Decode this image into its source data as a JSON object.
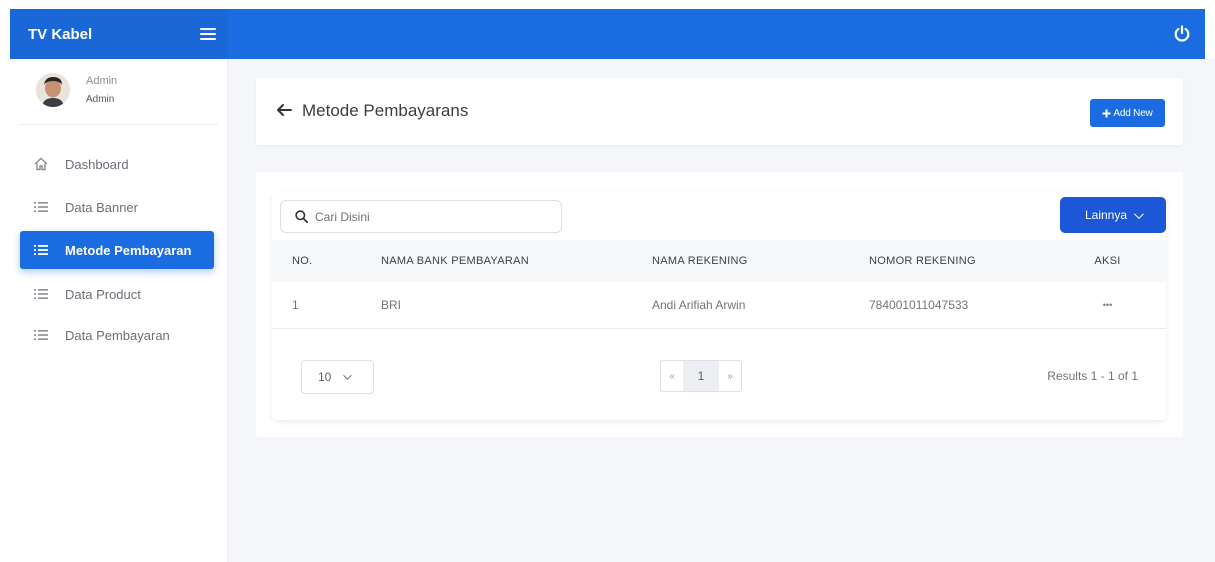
{
  "app": {
    "brand": "TV Kabel"
  },
  "profile": {
    "name": "Admin",
    "role": "Admin"
  },
  "sidebar": {
    "items": [
      {
        "label": "Dashboard",
        "icon": "home-icon",
        "active": false
      },
      {
        "label": "Data Banner",
        "icon": "list-icon",
        "active": false
      },
      {
        "label": "Metode Pembayaran",
        "icon": "list-icon",
        "active": true
      },
      {
        "label": "Data Product",
        "icon": "list-icon",
        "active": false
      },
      {
        "label": "Data Pembayaran",
        "icon": "list-icon",
        "active": false
      }
    ]
  },
  "header": {
    "title": "Metode Pembayarans",
    "add_label": "Add New"
  },
  "toolbar": {
    "search_placeholder": "Cari Disini",
    "more_label": "Lainnya"
  },
  "table": {
    "columns": [
      "NO.",
      "NAMA BANK PEMBAYARAN",
      "NAMA REKENING",
      "NOMOR REKENING",
      "AKSI"
    ],
    "rows": [
      {
        "no": "1",
        "bank": "BRI",
        "account_name": "Andi Arifiah Arwin",
        "account_number": "784001011047533",
        "action": "•••"
      }
    ]
  },
  "pagination": {
    "per_page": "10",
    "prev": "«",
    "current": "1",
    "next": "»",
    "results": "Results 1 - 1 of 1"
  },
  "colors": {
    "primary": "#1b6ce0",
    "button": "#1b57d6",
    "background": "#f4f6f9"
  }
}
